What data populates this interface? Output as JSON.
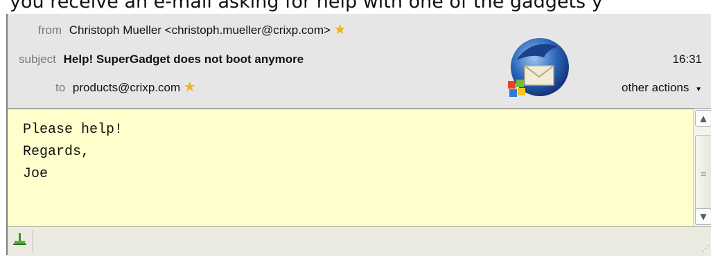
{
  "caption": "you receive an e-mail asking for help with one of the gadgets y",
  "header": {
    "from_label": "from",
    "from_value": "Christoph Mueller <christoph.mueller@crixp.com>",
    "subject_label": "subject",
    "subject_value": "Help! SuperGadget does not boot anymore",
    "to_label": "to",
    "to_value": "products@crixp.com",
    "time": "16:31",
    "other_actions": "other actions"
  },
  "message": {
    "body": "Please help!\nRegards,\nJoe"
  },
  "icons": {
    "star": "star-icon",
    "logo": "thunderbird-logo",
    "status": "online-status-icon"
  },
  "colors": {
    "header_bg": "#e6e6e6",
    "body_bg": "#ffffcc",
    "star": "#f2b21a"
  }
}
